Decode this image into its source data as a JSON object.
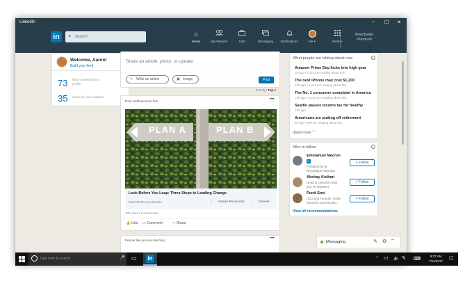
{
  "window": {
    "title": "LinkedIn",
    "minimize": "–",
    "maximize": "☐",
    "close": "✕"
  },
  "nav": {
    "logo": "in",
    "search_placeholder": "Search",
    "items": [
      {
        "label": "Home",
        "icon": "⌂"
      },
      {
        "label": "My Network",
        "icon": "👥"
      },
      {
        "label": "Jobs",
        "icon": "💼"
      },
      {
        "label": "Messaging",
        "icon": "✉"
      },
      {
        "label": "Notifications",
        "icon": "🔔"
      },
      {
        "label": "Me ▾"
      },
      {
        "label": "Work ▾",
        "icon": "⋮⋮⋮"
      }
    ],
    "premium": {
      "line1": "Reactivate",
      "line2": "Premium"
    }
  },
  "profile": {
    "welcome": "Welcome, Aaron!",
    "build_feed": "Build your feed",
    "stat1_value": "73",
    "stat1_label": "Who's viewed your profile",
    "stat2_value": "35",
    "stat2_label": "Views of your updates"
  },
  "share": {
    "prompt": "Share an article, photo, or update",
    "write_article": "Write an article",
    "image": "Image",
    "post": "Post",
    "sort_label": "Sort by:",
    "sort_value": "Top ▾"
  },
  "feed": {
    "liker": "Reid Hoffman likes this",
    "more": "•••",
    "sign_left": "PLAN A",
    "sign_right": "PLAN B",
    "article_title": "Look Before You Leap: Three Steps to Leading Change",
    "article_meta": "Brad Smith on LinkedIn",
    "tag1": "Human Resources",
    "tag2": "Careers",
    "counts": "276 Likes • 8 Comments",
    "like": "Like",
    "comment": "Comment",
    "share": "Share",
    "next_header": "People like you are learning"
  },
  "news": {
    "header": "What people are talking about now",
    "items": [
      {
        "title": "Amazon Prime Day kicks into high gear",
        "meta": "3h ago • 3,116 are reading about this"
      },
      {
        "title": "The next iPhone may cost $1,200",
        "meta": "23h ago • 2,212 are reading about this"
      },
      {
        "title": "The No. 1 consumer complaint in America",
        "meta": "13h ago • 2,142 are reading about this"
      },
      {
        "title": "Seattle passes income tax for healthy",
        "meta": "12h ago"
      },
      {
        "title": "Americans are putting off retirement",
        "meta": "5h ago • 569 are reading about this"
      }
    ],
    "show_more": "Show more"
  },
  "follow": {
    "header": "Who to follow",
    "people": [
      {
        "name": "Emmanuel Macron",
        "desc1": "Président de la",
        "desc2": "République française",
        "follow": "+ Follow"
      },
      {
        "name": "Akshay Kothari",
        "desc1": "Head of LinkedIn India",
        "desc2": "115.7K followers",
        "follow": "+ Follow"
      },
      {
        "name": "Punit Soni",
        "desc1": "CEO and Founder, Robin",
        "desc2": "(formerly Learning Mo...",
        "follow": "+ Follow"
      }
    ],
    "view_all": "View all recommendations"
  },
  "messaging": {
    "label": "Messaging"
  },
  "taskbar": {
    "search_placeholder": "Type here to search",
    "time": "9:37 AM",
    "date": "7/11/2017",
    "linkedin_icon": "in"
  },
  "colors": {
    "navy": "#283e4a",
    "brand": "#0077b5",
    "link": "#0073b1",
    "online": "#5aab3a"
  }
}
